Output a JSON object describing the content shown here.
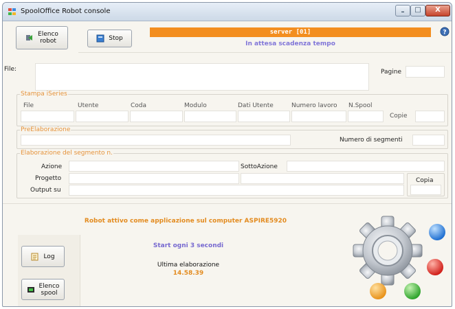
{
  "window": {
    "title": "SpoolOffice Robot console",
    "controls": {
      "minimize": "–",
      "maximize": "□",
      "close": "X"
    }
  },
  "toolbar": {
    "elenco_robot": "Elenco\nrobot",
    "stop": "Stop"
  },
  "server": {
    "label": "server [01]",
    "status": "In attesa scadenza tempo"
  },
  "file_row": {
    "file_label": "File:",
    "pagine_label": "Pagine"
  },
  "stampa": {
    "legend": "Stampa iSeries",
    "columns": [
      "File",
      "Utente",
      "Coda",
      "Modulo",
      "Dati Utente",
      "Numero lavoro",
      "N.Spool"
    ],
    "copie_label": "Copie"
  },
  "preelaborazione": {
    "legend": "PreElaborazione",
    "segmenti_label": "Numero di segmenti"
  },
  "elaborazione": {
    "legend": "Elaborazione del segmento n.",
    "azione_label": "Azione",
    "sottoazione_label": "SottoAzione",
    "progetto_label": "Progetto",
    "output_label": "Output su",
    "copia_label": "Copia"
  },
  "messages": {
    "robot_active": "Robot attivo come applicazione sul computer ASPIRE5920",
    "start_every": "Start ogni 3 secondi",
    "last_run_label": "Ultima elaborazione",
    "last_run_time": "14.58.39"
  },
  "side_buttons": {
    "log": "Log",
    "elenco_spool": "Elenco\nspool"
  },
  "colors": {
    "accent_orange": "#f38e1f",
    "status_purple": "#8075d8",
    "legend_orange": "#e5923a"
  },
  "icons": [
    "app-icon",
    "green-arrow-icon",
    "stop-icon",
    "help-icon",
    "log-icon",
    "spool-icon",
    "gear-icon"
  ]
}
